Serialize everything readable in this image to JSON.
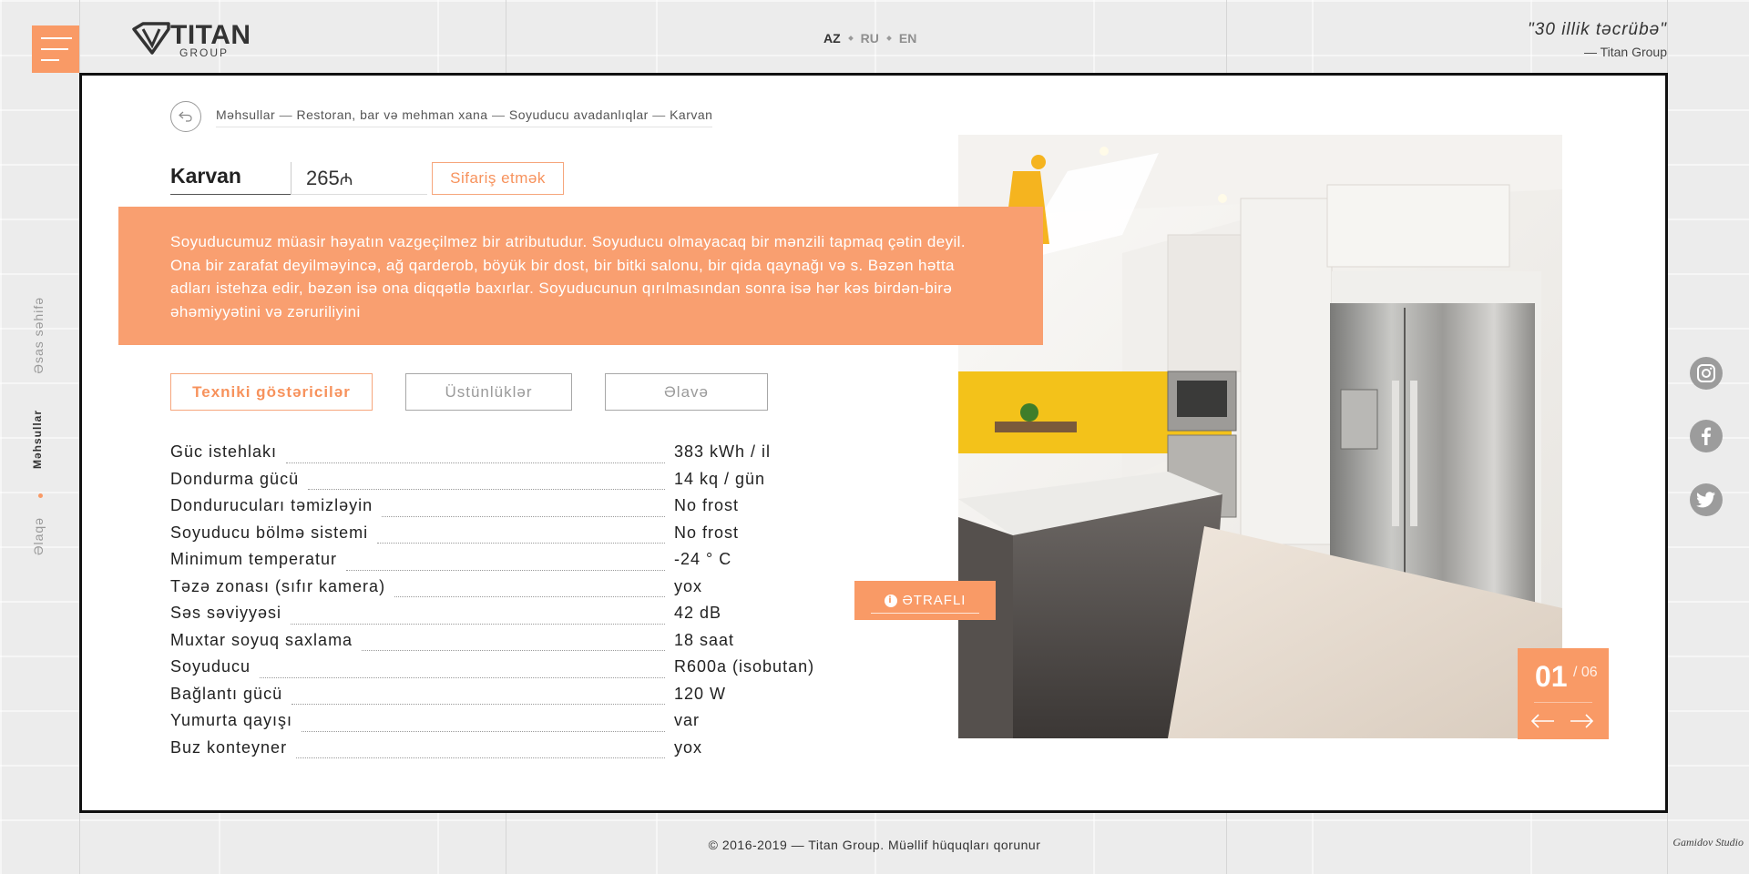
{
  "header": {
    "logo": {
      "title": "TITAN",
      "subtitle": "GROUP"
    },
    "languages": [
      "AZ",
      "RU",
      "EN"
    ],
    "active_language": "AZ",
    "quote": "\"30 illik təcrübə\"",
    "quote_author": "— Titan Group"
  },
  "sidenav": {
    "items": [
      {
        "label": "Əsas səhifə",
        "active": false
      },
      {
        "label": "Məhsullar",
        "active": true
      },
      {
        "label": "Əlaqə",
        "active": false
      }
    ]
  },
  "social": {
    "icons": [
      "instagram-icon",
      "facebook-icon",
      "twitter-icon"
    ]
  },
  "breadcrumb": {
    "items": [
      "Məhsullar",
      "Restoran, bar və mehman xana",
      "Soyuducu avadanlıqlar",
      "Karvan"
    ],
    "separator": "—"
  },
  "product": {
    "name": "Karvan",
    "price": "265",
    "currency": "₼",
    "order_label": "Sifariş etmək",
    "description": "Soyuducumuz müasir həyatın vazgeçilmez bir atributudur. Soyuducu olmayacaq bir mənzili tapmaq çətin deyil. Ona bir zarafat deyilməyincə, ağ qarderob, böyük bir dost, bir bitki salonu, bir qida qaynağı və s. Bəzən hətta adları istehza edir, bəzən isə ona diqqətlə baxırlar. Soyuducunun qırılmasından sonra isə hər kəs birdən-birə əhəmiyyətini və zəruriliyini"
  },
  "tabs": [
    {
      "label": "Texniki göstəricilər",
      "active": true
    },
    {
      "label": "Üstünlüklər",
      "active": false
    },
    {
      "label": "Əlavə",
      "active": false
    }
  ],
  "specs": [
    {
      "label": "Güc istehlakı",
      "value": "383 kWh / il"
    },
    {
      "label": "Dondurma gücü",
      "value": "14 kq / gün"
    },
    {
      "label": "Dondurucuları təmizləyin",
      "value": "No frost"
    },
    {
      "label": "Soyuducu bölmə sistemi",
      "value": "No frost"
    },
    {
      "label": "Minimum temperatur",
      "value": "-24 ° C"
    },
    {
      "label": "Təzə zonası (sıfır kamera)",
      "value": "yox"
    },
    {
      "label": "Səs səviyyəsi",
      "value": "42 dB"
    },
    {
      "label": "Muxtar soyuq saxlama",
      "value": "18 saat"
    },
    {
      "label": "Soyuducu",
      "value": "R600a (isobutan)"
    },
    {
      "label": "Bağlantı gücü",
      "value": "120 W"
    },
    {
      "label": "Yumurta qayışı",
      "value": "var"
    },
    {
      "label": "Buz konteyner",
      "value": "yox"
    }
  ],
  "details_button": {
    "label": "ƏTRAFLI",
    "icon": "info-icon"
  },
  "slider": {
    "current": "01",
    "total": "/ 06"
  },
  "footer": {
    "copyright": "© 2016-2019 — Titan Group. Müəllif hüquqları qorunur",
    "studio": "Gamidov Studio"
  },
  "colors": {
    "accent": "#f99a66",
    "accent_text": "#f7925c",
    "card_border": "#111111"
  }
}
